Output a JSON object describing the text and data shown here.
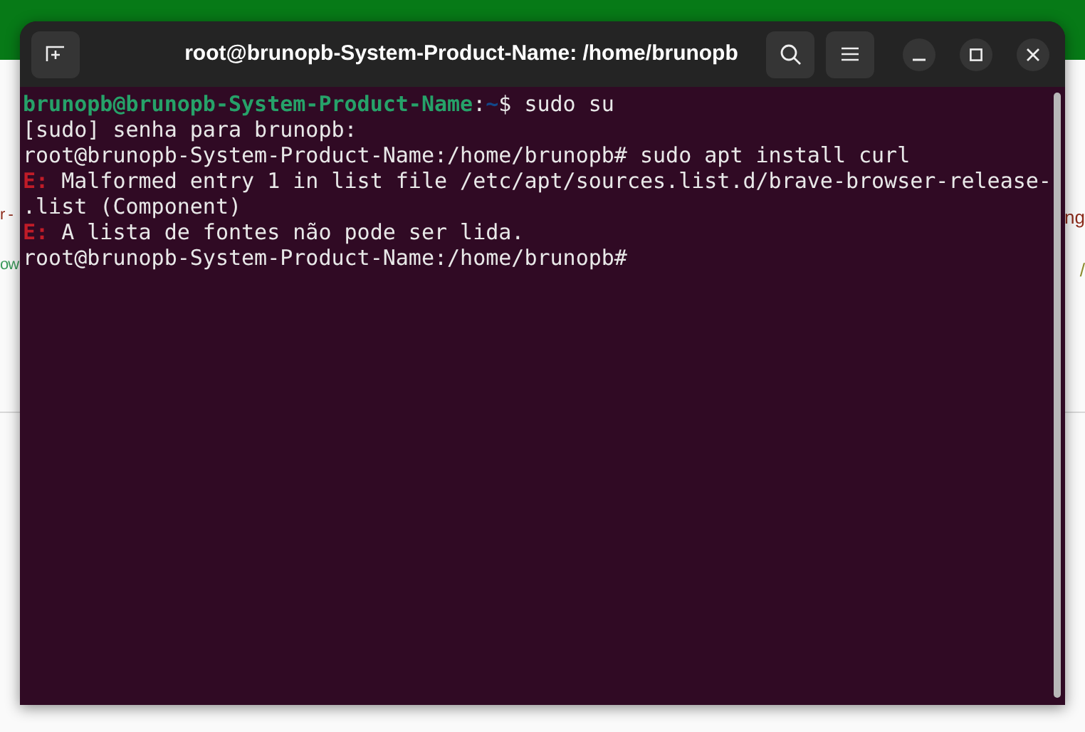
{
  "background": {
    "left_fragments": [
      {
        "text": "r -",
        "color": "#8b2a1a"
      },
      {
        "text": "ow",
        "color": "#3a9a5a"
      }
    ],
    "right_fragments": [
      {
        "text": "ng",
        "color": "#8b2a1a"
      },
      {
        "text": "/",
        "color": "#8a8a2a"
      }
    ]
  },
  "window": {
    "title": "root@brunopb-System-Product-Name: /home/brunopb"
  },
  "terminal": {
    "lines": [
      [
        {
          "kind": "user",
          "text": "brunopb@brunopb-System-Product-Name"
        },
        {
          "kind": "plain",
          "text": ":"
        },
        {
          "kind": "path",
          "text": "~"
        },
        {
          "kind": "plain",
          "text": "$ sudo su"
        }
      ],
      [
        {
          "kind": "plain",
          "text": "[sudo] senha para brunopb:"
        }
      ],
      [
        {
          "kind": "plain",
          "text": "root@brunopb-System-Product-Name:/home/brunopb# sudo apt install curl"
        }
      ],
      [
        {
          "kind": "error",
          "text": "E:"
        },
        {
          "kind": "plain",
          "text": " Malformed entry 1 in list file /etc/apt/sources.list.d/brave-browser-release-"
        }
      ],
      [
        {
          "kind": "plain",
          "text": ".list (Component)"
        }
      ],
      [
        {
          "kind": "error",
          "text": "E:"
        },
        {
          "kind": "plain",
          "text": " A lista de fontes não pode ser lida."
        }
      ],
      [
        {
          "kind": "plain",
          "text": "root@brunopb-System-Product-Name:/home/brunopb#"
        }
      ]
    ]
  }
}
